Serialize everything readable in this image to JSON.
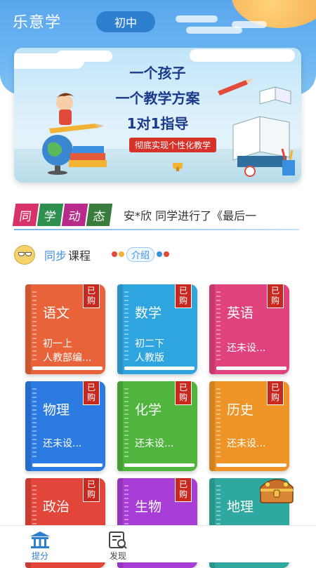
{
  "header": {
    "app_title": "乐意学",
    "grade": "初中"
  },
  "banner": {
    "line1": "一个孩子",
    "line2": "一个教学方案",
    "line3": "1对1指导",
    "tagline": "彻底实现个性化教学"
  },
  "news": {
    "badge_chars": [
      "同",
      "学",
      "动",
      "态"
    ],
    "badge_colors": [
      "#d8326a",
      "#2f8f4e",
      "#b72b8a",
      "#3a7c3e"
    ],
    "text": "安*欣 同学进行了《最后一"
  },
  "section": {
    "title_sync": "同步",
    "title_course": "课程",
    "intro_label": "介绍"
  },
  "subjects": [
    {
      "name": "语文",
      "line1": "初一上",
      "line2": "人教部编...",
      "tag": "已购",
      "color": "#e8623a"
    },
    {
      "name": "数学",
      "line1": "初二下",
      "line2": "人教版",
      "tag": "已购",
      "color": "#2fa5df"
    },
    {
      "name": "英语",
      "line1": "还未设...",
      "line2": "",
      "tag": "已购",
      "color": "#e0427e"
    },
    {
      "name": "物理",
      "line1": "还未设...",
      "line2": "",
      "tag": "已购",
      "color": "#2c7be3"
    },
    {
      "name": "化学",
      "line1": "还未设...",
      "line2": "",
      "tag": "已购",
      "color": "#4fb53c"
    },
    {
      "name": "历史",
      "line1": "还未设...",
      "line2": "",
      "tag": "已购",
      "color": "#ef9426"
    },
    {
      "name": "政治",
      "line1": "",
      "line2": "",
      "tag": "已购",
      "color": "#e2453a"
    },
    {
      "name": "生物",
      "line1": "",
      "line2": "",
      "tag": "已购",
      "color": "#a83ed6"
    },
    {
      "name": "地理",
      "line1": "",
      "line2": "",
      "tag": "",
      "color": "#2fa9a0"
    }
  ],
  "bottom_nav": {
    "items": [
      {
        "label": "提分",
        "icon": "building-icon",
        "active": true
      },
      {
        "label": "发现",
        "icon": "discover-icon",
        "active": false
      }
    ],
    "active_color": "#2f7fcf",
    "inactive_color": "#444444"
  }
}
